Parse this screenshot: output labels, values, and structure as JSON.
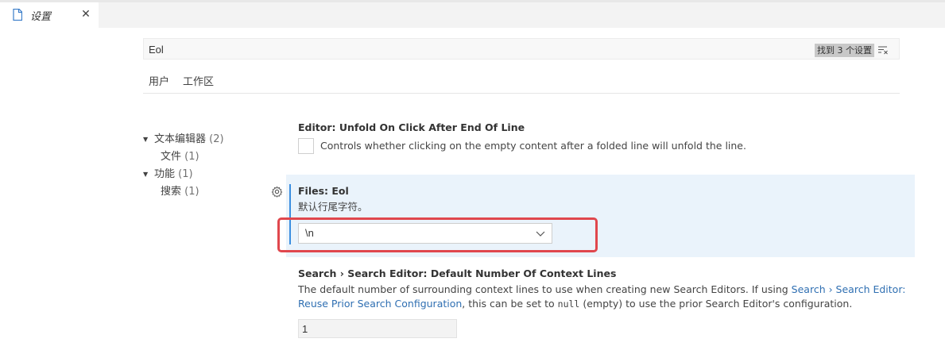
{
  "tab": {
    "title": "设置",
    "close_glyph": "✕",
    "icon": "file-icon"
  },
  "search": {
    "value": "Eol",
    "results": "找到 3 个设置",
    "clear_icon": "clear-filter-icon"
  },
  "scope_tabs": [
    "用户",
    "工作区"
  ],
  "toc": [
    {
      "label": "文本编辑器",
      "count": "(2)",
      "expanded": true,
      "level": 0
    },
    {
      "label": "文件",
      "count": "(1)",
      "level": 1
    },
    {
      "label": "功能",
      "count": "(1)",
      "expanded": true,
      "level": 0
    },
    {
      "label": "搜索",
      "count": "(1)",
      "level": 1
    }
  ],
  "settings": {
    "unfold": {
      "title": "Editor: Unfold On Click After End Of Line",
      "description": "Controls whether clicking on the empty content after a folded line will unfold the line.",
      "checked": false
    },
    "eol": {
      "title": "Files: Eol",
      "description": "默认行尾字符。",
      "value": "\\n",
      "highlight_color": "#e0474d"
    },
    "search_context": {
      "title": "Search › Search Editor: Default Number Of Context Lines",
      "desc_part1": "The default number of surrounding context lines to use when creating new Search Editors. If using ",
      "desc_link": "Search › Search Editor: Reuse Prior Search Configuration",
      "desc_part2": ", this can be set to ",
      "desc_code": "null",
      "desc_part3": " (empty) to use the prior Search Editor's configuration.",
      "value": "1"
    }
  },
  "colors": {
    "accent": "#3b8ee0",
    "link": "#2f6fb2",
    "focus_bg": "#eaf3fb"
  }
}
